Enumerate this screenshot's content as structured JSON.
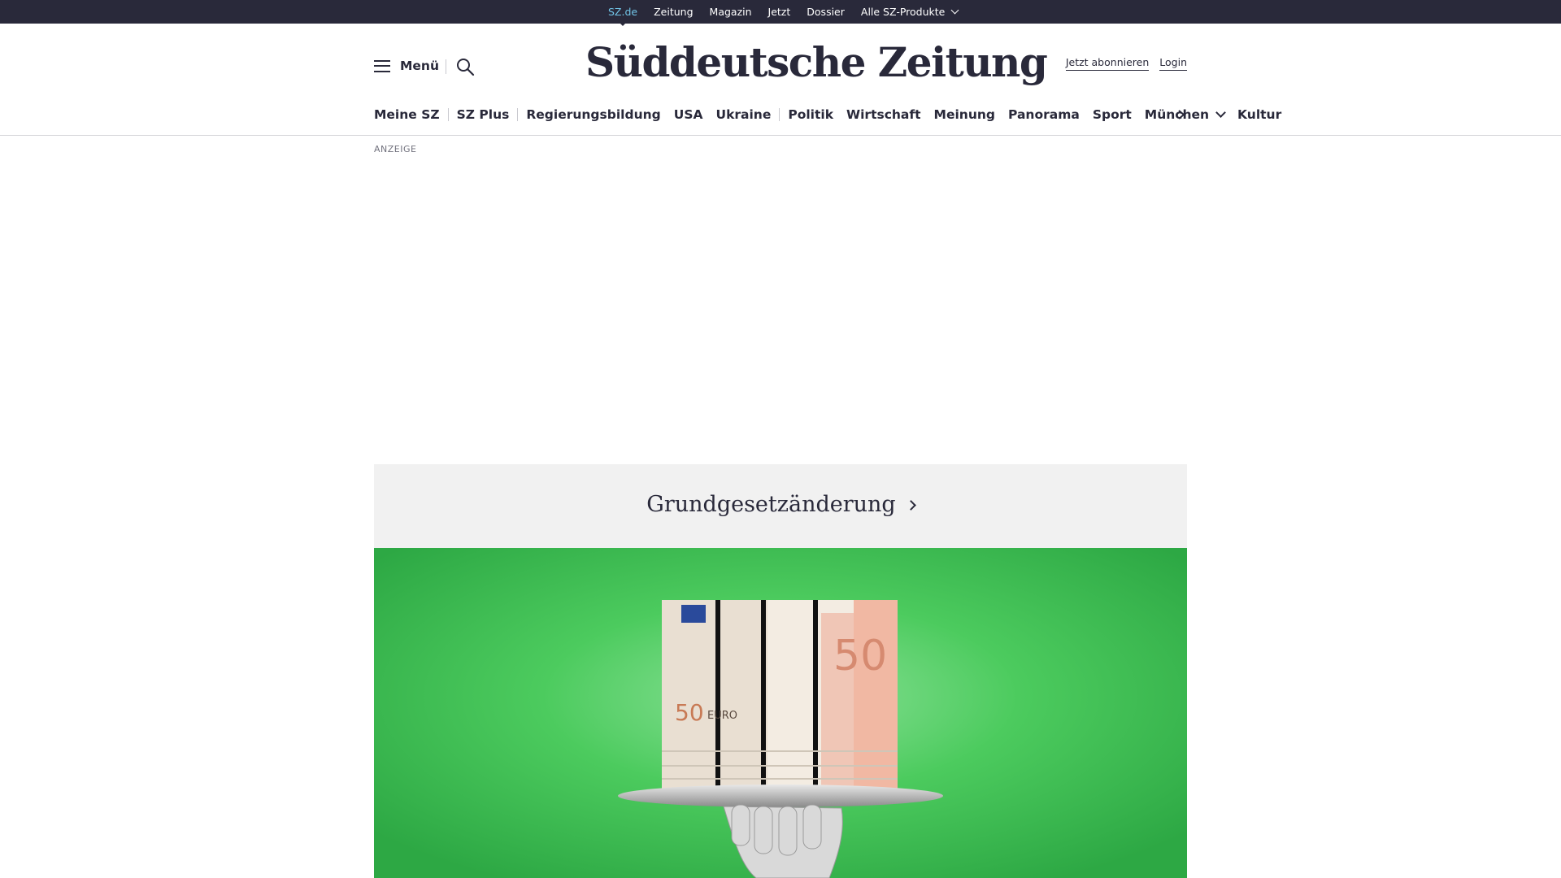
{
  "topbar": {
    "links": [
      "SZ.de",
      "Zeitung",
      "Magazin",
      "Jetzt",
      "Dossier",
      "Alle SZ-Produkte"
    ]
  },
  "header": {
    "menu_label": "Menü",
    "logo": "Süddeutsche Zeitung",
    "subscribe_label": "Jetzt abonnieren",
    "login_label": "Login"
  },
  "nav": {
    "items": [
      "Meine SZ",
      "SZ Plus",
      "Regierungsbildung",
      "USA",
      "Ukraine",
      "Politik",
      "Wirtschaft",
      "Meinung",
      "Panorama",
      "Sport",
      "München",
      "Kultur"
    ]
  },
  "ad": {
    "label": "ANZEIGE"
  },
  "topic": {
    "title": "Grundgesetzänderung"
  },
  "hero": {
    "banknote_value": "50",
    "banknote_currency": "EURO",
    "background_color": "#3ec455",
    "icons": [
      "menu-icon",
      "search-icon",
      "chevron-down-icon",
      "chevron-right-icon"
    ]
  }
}
